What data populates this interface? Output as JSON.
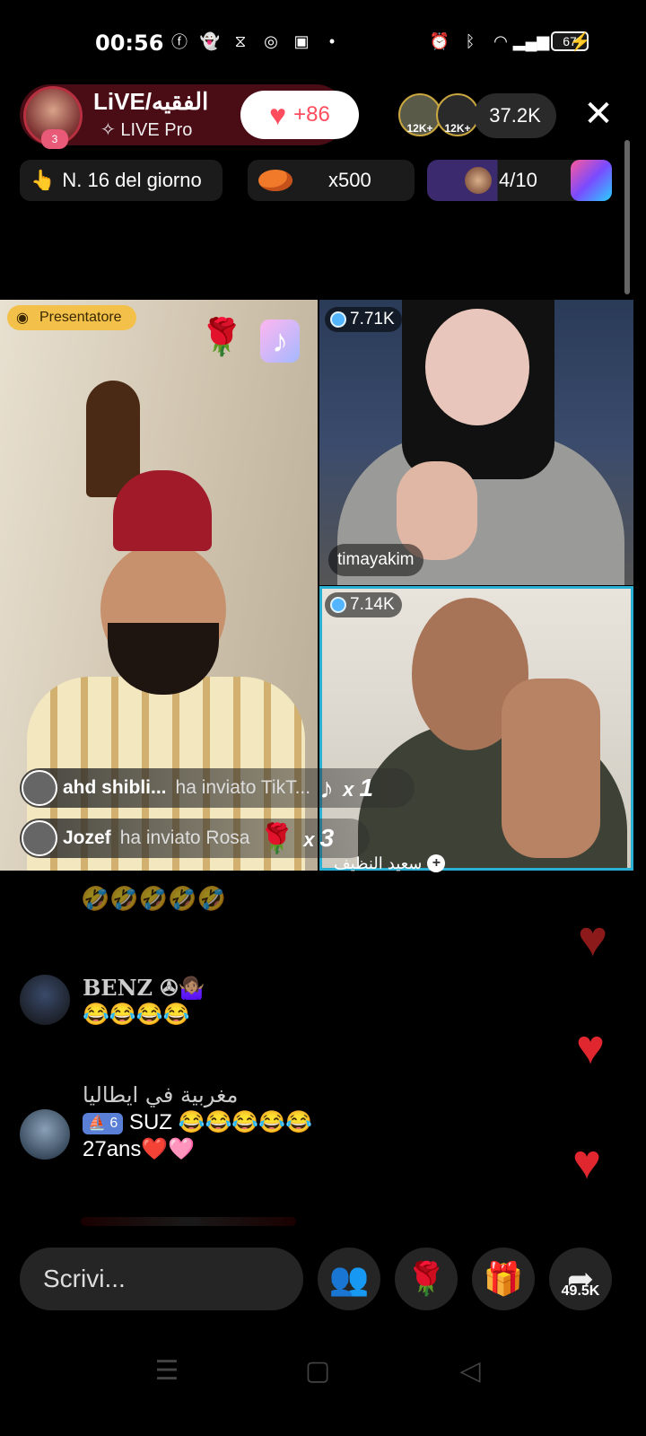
{
  "status_bar": {
    "time": "00:56",
    "battery": "67",
    "left_icons": [
      "facebook-icon",
      "snapchat-icon",
      "capcut-icon",
      "instagram-icon",
      "app-icon",
      "dot"
    ],
    "right_icons": [
      "alarm-icon",
      "bluetooth-icon",
      "wifi-icon",
      "signal-icon",
      "battery-icon"
    ]
  },
  "host": {
    "name": "LiVE/الفقيه",
    "subtitle": "✧ LIVE Pro",
    "level": "3",
    "likes": "+86"
  },
  "viewers": {
    "avatar_badges": [
      "12K+",
      "12K+"
    ],
    "count": "37.2K"
  },
  "chips": {
    "rank": "N. 16 del giorno",
    "multiplier": "x500",
    "guests": "4/10"
  },
  "videos": {
    "host_tag": "Presentatore",
    "guest1_score": "7.71K",
    "guest1_name": "timayakim",
    "guest2_score": "7.14K",
    "guest2_name": "سعيد النظيف"
  },
  "gifts": [
    {
      "user": "ahd shibli...",
      "text": "ha inviato TikT...",
      "icon": "tiktok-gift",
      "count_prefix": "x",
      "count": "1"
    },
    {
      "user": "Jozef",
      "text": "ha inviato Rosa",
      "icon": "rose-gift",
      "count_prefix": "x",
      "count": "3"
    }
  ],
  "chat": {
    "faded_top": "🤣🤣🤣🤣🤣",
    "messages": [
      {
        "name": "BENZ ✇🤷🏽‍♀️",
        "text": "😂😂😂😂"
      },
      {
        "name": "مغربية في ايطاليا",
        "badge": "⛵ 6",
        "sub": "SUZ",
        "text": "😂😂😂😂😂",
        "text2": "27ans❤️🩷"
      }
    ]
  },
  "bottom": {
    "input_placeholder": "Scrivi...",
    "share_count": "49.5K"
  },
  "colors": {
    "accent_pink": "#ff4d5e",
    "host_tag": "#f3c14a",
    "guest_highlight": "#2ab0d4"
  }
}
